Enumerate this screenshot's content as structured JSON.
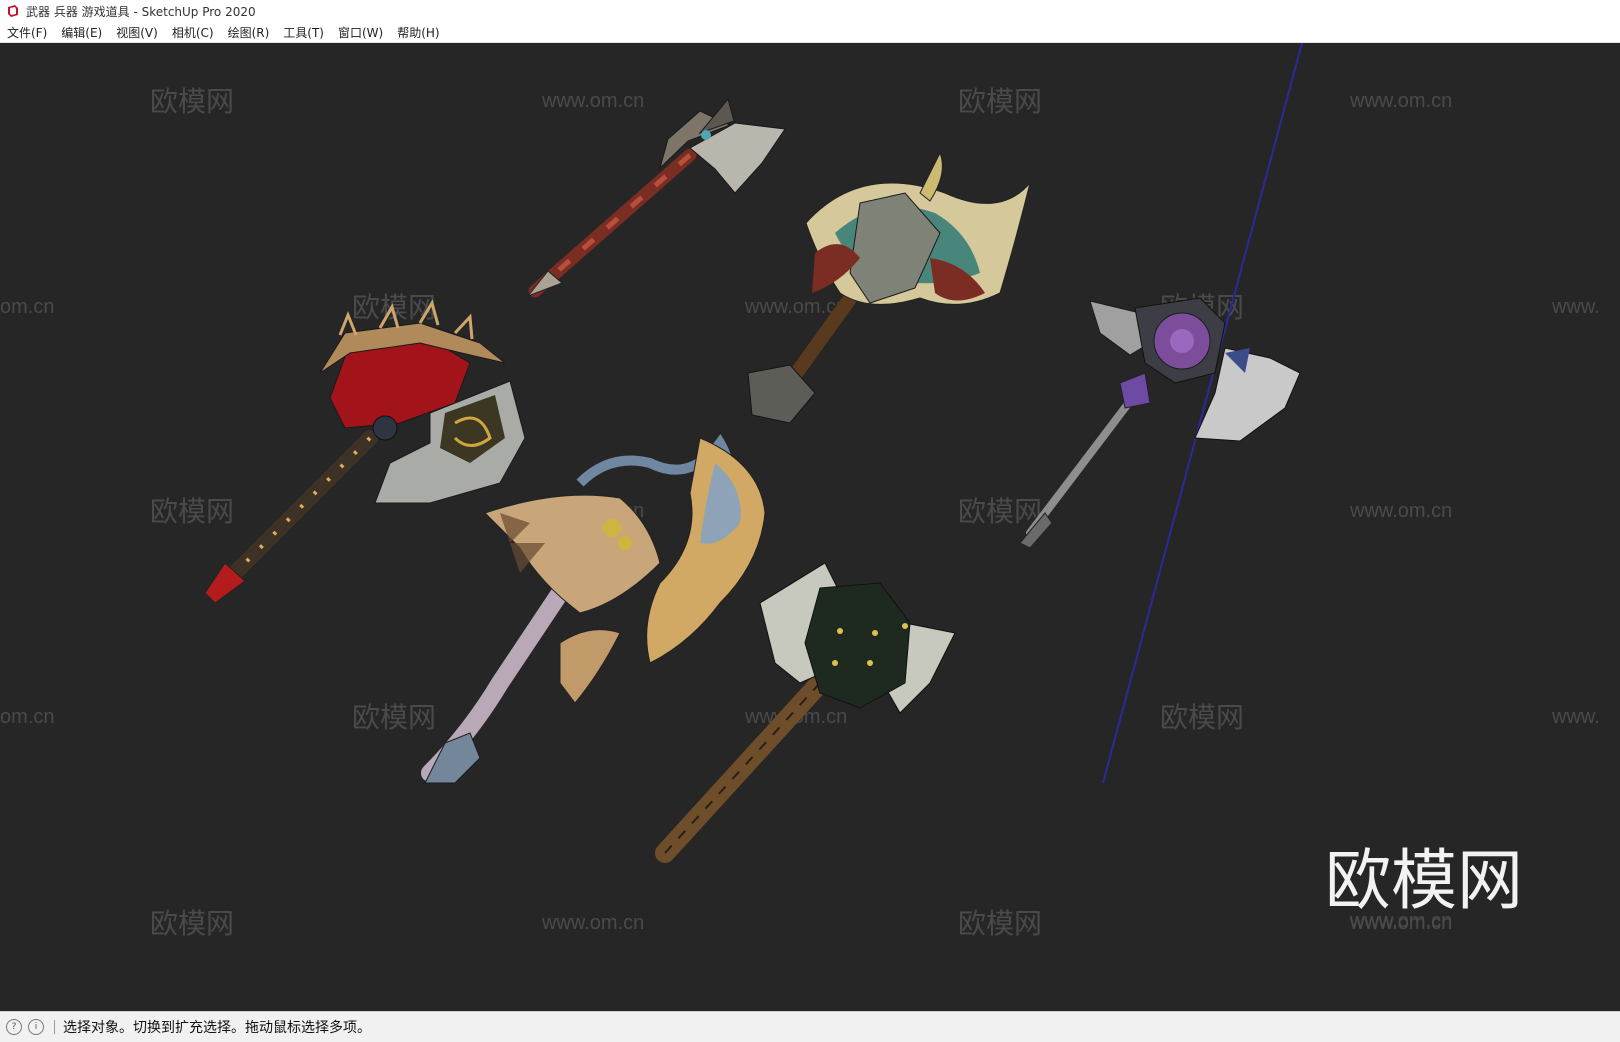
{
  "window": {
    "title": "武器 兵器 游戏道具 - SketchUp Pro 2020"
  },
  "menu": {
    "items": [
      "文件(F)",
      "编辑(E)",
      "视图(V)",
      "相机(C)",
      "绘图(R)",
      "工具(T)",
      "窗口(W)",
      "帮助(H)"
    ]
  },
  "watermarks": {
    "site": "www.om.cn",
    "brand": "欧模网",
    "site_partial_left": "om.cn",
    "site_partial_right": "www."
  },
  "logo": {
    "text": "欧模网",
    "subtext": "www.om.cn"
  },
  "status": {
    "message": "选择对象。切换到扩充选择。拖动鼠标选择多项。"
  },
  "colors": {
    "viewport_bg": "#262626",
    "axis_line": "#2a2a9c"
  },
  "icons": {
    "app": "sketchup-icon",
    "status_geo": "geolocation-icon",
    "status_info": "info-icon"
  }
}
